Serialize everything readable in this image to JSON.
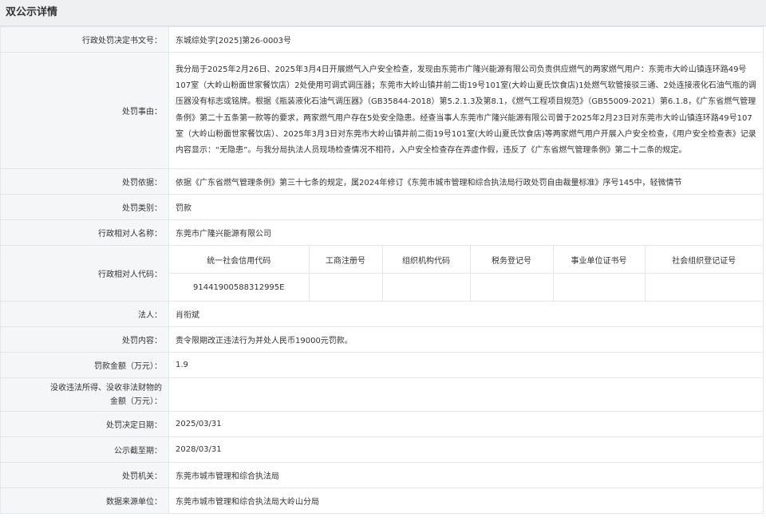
{
  "title": "双公示详情",
  "rows": {
    "doc_no": {
      "label": "行政处罚决定书文号：",
      "value": "东城综处字[2025]第26-0003号"
    },
    "reason": {
      "label": "处罚事由：",
      "value": "我分局于2025年2月26日、2025年3月4日开展燃气入户安全检查，发现由东莞市广隆兴能源有限公司负责供应燃气的两家燃气用户：东莞市大岭山镇连环路49号107室（大岭山粉面世家餐饮店）2处使用可调式调压器；东莞市大岭山镇井前二街19号101室(大岭山夏氏饮食店)1处燃气软管接驳三通、2处连接液化石油气瓶的调压器没有标志或铭牌。根据《瓶装液化石油气调压器》（GB35844-2018）第5.2.1.3及第8.1，《燃气工程项目规范》（GB55009-2021）第6.1.8，《广东省燃气管理条例》第二十五条第一款等的要求，两家燃气用户存在5处安全隐患。经查当事人东莞市广隆兴能源有限公司曾于2025年2月23日对东莞市大岭山镇连环路49号107室（大岭山粉面世家餐饮店）、2025年3月3日对东莞市大岭山镇井前二街19号101室(大岭山夏氏饮食店)等两家燃气用户开展入户安全检查，《用户安全检查表》记录内容显示：“无隐患”。与我分局执法人员现场检查情况不相符，入户安全检查存在弄虚作假，违反了《广东省燃气管理条例》第二十二条的规定。"
    },
    "basis": {
      "label": "处罚依据：",
      "value": "依据《广东省燃气管理条例》第三十七条的规定，属2024年修订《东莞市城市管理和综合执法局行政处罚自由裁量标准》序号145中，轻微情节"
    },
    "category": {
      "label": "处罚类别：",
      "value": "罚款"
    },
    "party_name": {
      "label": "行政相对人名称：",
      "value": "东莞市广隆兴能源有限公司"
    },
    "party_code": {
      "label": "行政相对人代码：",
      "headers": [
        "统一社会信用代码",
        "工商注册号",
        "组织机构代码",
        "税务登记号",
        "事业单位证书号",
        "社会组织登记证号"
      ],
      "values": [
        "91441900588312995E",
        "",
        "",
        "",
        "",
        ""
      ]
    },
    "legal_rep": {
      "label": "法人：",
      "value": "肖衔斌"
    },
    "content": {
      "label": "处罚内容：",
      "value": "责令限期改正违法行为并处人民币19000元罚款。"
    },
    "amount": {
      "label": "罚款金额（万元）：",
      "value": "1.9"
    },
    "confiscation": {
      "label_line1": "没收违法所得、没收非法财物的",
      "label_line2": "金额（万元）：",
      "value": ""
    },
    "decision_date": {
      "label": "处罚决定日期：",
      "value": "2025/03/31"
    },
    "expiry_date": {
      "label": "公示截至期：",
      "value": "2028/03/31"
    },
    "authority": {
      "label": "处罚机关：",
      "value": "东莞市城市管理和综合执法局"
    },
    "source": {
      "label": "数据来源单位：",
      "value": "东莞市城市管理和综合执法局大岭山分局"
    }
  }
}
